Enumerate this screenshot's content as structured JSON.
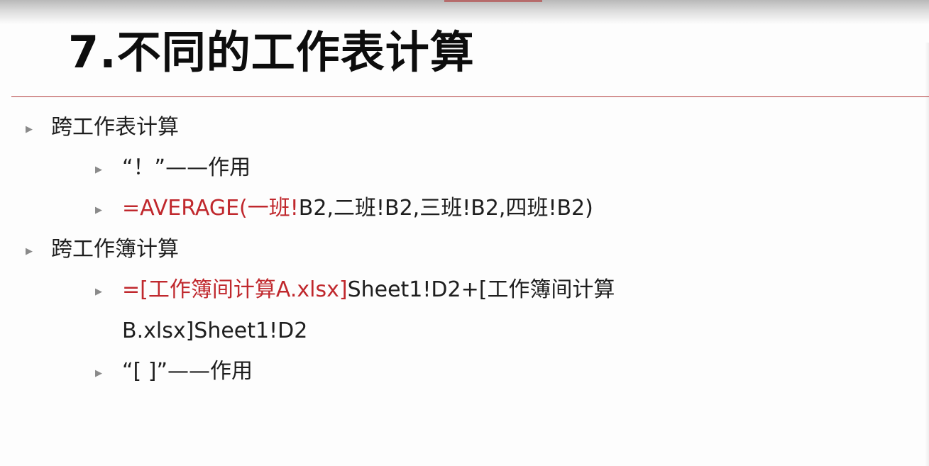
{
  "slide": {
    "title": "7.不同的工作表计算",
    "items": [
      {
        "level": 1,
        "text": "跨工作表计算"
      },
      {
        "level": 2,
        "text": "“！”——作用"
      },
      {
        "level": 2,
        "red": "=AVERAGE(一班!",
        "rest": "B2,二班!B2,三班!B2,四班!B2)"
      },
      {
        "level": 1,
        "text": "跨工作簿计算"
      },
      {
        "level": 2,
        "red": "=[工作簿间计算A.xlsx]",
        "rest": "Sheet1!D2+[工作簿间计算",
        "continuation": "B.xlsx]Sheet1!D2"
      },
      {
        "level": 2,
        "text": "“[  ]”——作用"
      }
    ]
  },
  "colors": {
    "accent_red": "#c0282d",
    "rule_red": "#b13a3a",
    "text": "#1e1e1e"
  },
  "icons": {
    "bullet": "triangle-right-icon"
  }
}
